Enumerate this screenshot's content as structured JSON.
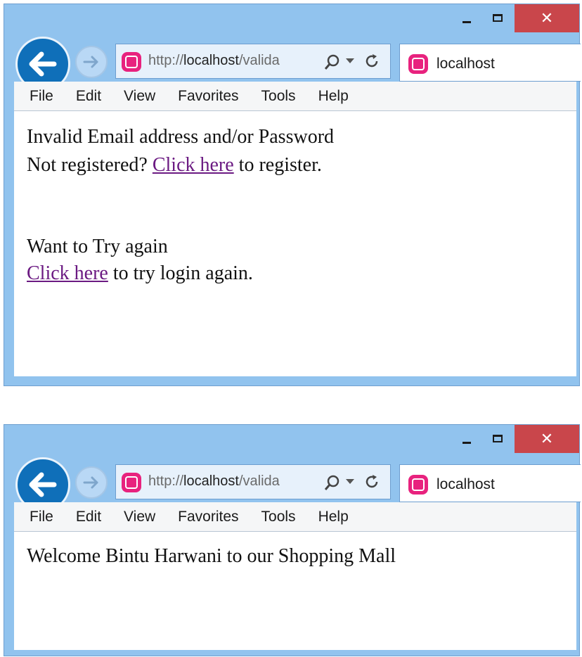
{
  "windows": [
    {
      "close_glyph": "✕",
      "address_bar": {
        "url_prefix": "http://",
        "url_host": "localhost",
        "url_rest": "/valida"
      },
      "tab_title": "localhost",
      "menu": [
        "File",
        "Edit",
        "View",
        "Favorites",
        "Tools",
        "Help"
      ],
      "page": {
        "error_line": "Invalid Email address and/or Password",
        "not_registered_text": "Not registered?",
        "register_link": "Click here",
        "register_suffix": "to register.",
        "retry_line": "Want to Try again",
        "login_link": "Click here",
        "login_suffix": "to try login again."
      }
    },
    {
      "close_glyph": "✕",
      "address_bar": {
        "url_prefix": "http://",
        "url_host": "localhost",
        "url_rest": "/valida"
      },
      "tab_title": "localhost",
      "menu": [
        "File",
        "Edit",
        "View",
        "Favorites",
        "Tools",
        "Help"
      ],
      "page": {
        "welcome_line": "Welcome Bintu Harwani to our Shopping Mall"
      }
    }
  ],
  "colors": {
    "frame": "#91c3ee",
    "close_button": "#c9464b",
    "back_button": "#0f6fb9",
    "favicon": "#e8227e",
    "visited_link": "#6b1a82"
  },
  "icons": [
    "back-arrow-icon",
    "forward-arrow-icon",
    "wampserver-favicon-icon",
    "search-icon",
    "dropdown-arrow-icon",
    "refresh-icon",
    "minimize-icon",
    "maximize-icon",
    "close-icon"
  ]
}
